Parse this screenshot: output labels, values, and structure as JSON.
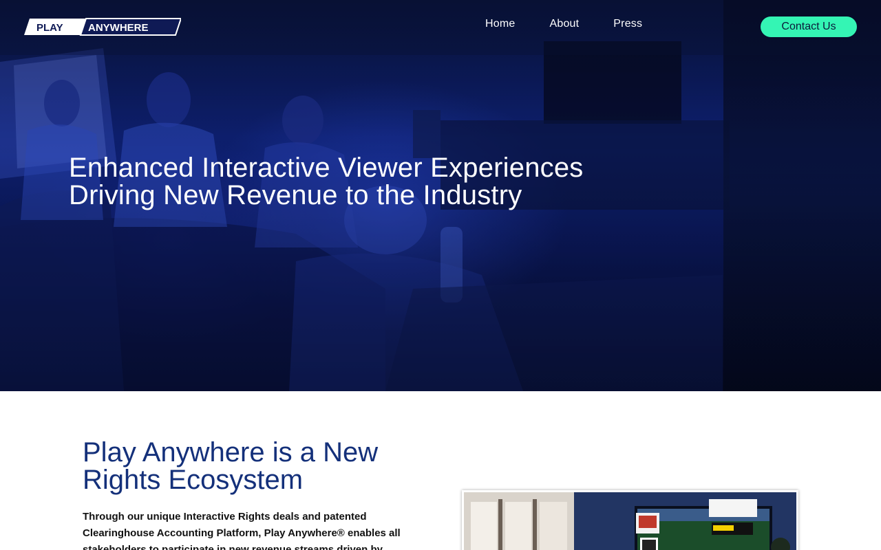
{
  "header": {
    "logo_alt": "PLAY ANYWHERE",
    "logo_left": "PLAY",
    "logo_right": "ANYWHERE",
    "nav": [
      {
        "label": "Home"
      },
      {
        "label": "About"
      },
      {
        "label": "Press"
      }
    ],
    "contact_label": "Contact Us"
  },
  "hero": {
    "title_line1": "Enhanced Interactive Viewer Experiences",
    "title_line2": "Driving New Revenue to the Industry"
  },
  "intro": {
    "title_line1": "Play Anywhere is a New",
    "title_line2": "Rights Ecosystem",
    "body": "Through our unique Interactive Rights deals and patented Clearinghouse Accounting Platform, Play Anywhere® enables all stakeholders to participate in new revenue streams driven by"
  },
  "colors": {
    "accent": "#34f5b4",
    "heading_blue": "#14307a",
    "hero_blue": "#0d1f6e"
  }
}
